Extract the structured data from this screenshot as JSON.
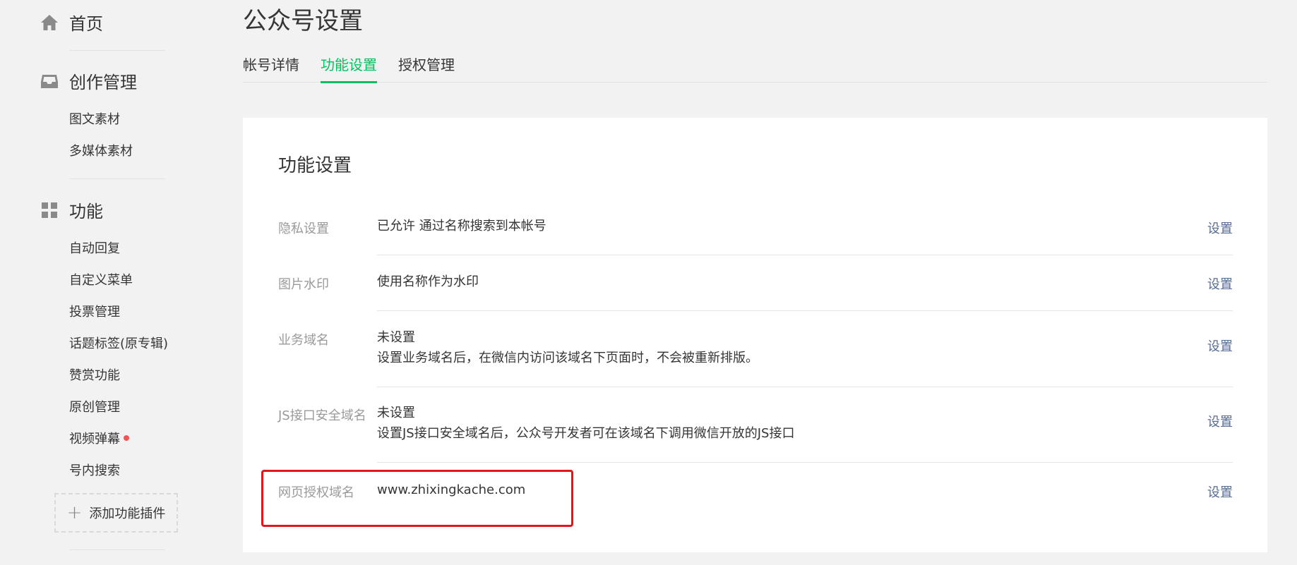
{
  "sidebar": {
    "home": {
      "label": "首页",
      "icon": "home-icon"
    },
    "content": {
      "label": "创作管理",
      "icon": "inbox-icon",
      "items": [
        "图文素材",
        "多媒体素材"
      ]
    },
    "features": {
      "label": "功能",
      "icon": "grid-icon",
      "items": [
        "自动回复",
        "自定义菜单",
        "投票管理",
        "话题标签(原专辑)",
        "赞赏功能",
        "原创管理",
        "视频弹幕",
        "号内搜索"
      ],
      "add_plugin": "添加功能插件"
    }
  },
  "page_title": "公众号设置",
  "tabs": [
    {
      "label": "帐号详情",
      "active": false
    },
    {
      "label": "功能设置",
      "active": true
    },
    {
      "label": "授权管理",
      "active": false
    }
  ],
  "section": {
    "title": "功能设置",
    "rows": [
      {
        "label": "隐私设置",
        "value": "已允许 通过名称搜索到本帐号",
        "action": "设置"
      },
      {
        "label": "图片水印",
        "value": "使用名称作为水印",
        "action": "设置"
      },
      {
        "label": "业务域名",
        "value": "未设置",
        "desc": "设置业务域名后，在微信内访问该域名下页面时，不会被重新排版。",
        "action": "设置"
      },
      {
        "label": "JS接口安全域名",
        "value": "未设置",
        "desc": "设置JS接口安全域名后，公众号开发者可在该域名下调用微信开放的JS接口",
        "action": "设置"
      },
      {
        "label": "网页授权域名",
        "value": "www.zhixingkache.com",
        "action": "设置"
      }
    ]
  },
  "colors": {
    "accent": "#07c160",
    "link": "#576b95",
    "highlight_box": "#e4141b",
    "notification_dot": "#fa5151"
  }
}
